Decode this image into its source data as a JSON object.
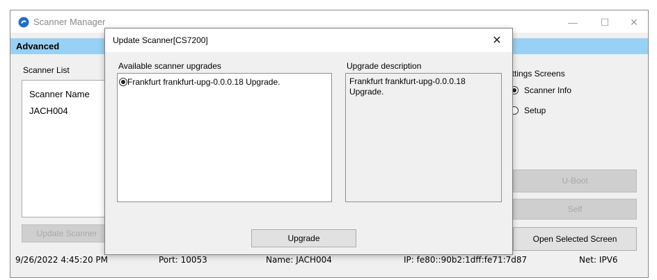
{
  "app": {
    "title": "Scanner Manager",
    "tab": "Advanced",
    "controls": {
      "minimize": "—",
      "maximize": "☐",
      "close": "✕"
    }
  },
  "scanner_list": {
    "label": "Scanner List",
    "column_header": "Scanner Name",
    "rows": [
      "JACH004"
    ],
    "update_button": "Update Scanner"
  },
  "settings": {
    "label": "Settings Screens",
    "options": [
      {
        "label": "Scanner Info",
        "selected": true
      },
      {
        "label": "Setup",
        "selected": false
      }
    ],
    "button_1": "U-Boot",
    "button_2": "Self",
    "open_button": "Open Selected Screen"
  },
  "status_bar": {
    "datetime": "9/26/2022 4:45:20 PM",
    "port": "Port: 10053",
    "name": "Name: JACH004",
    "ip": "IP: fe80::90b2:1dff:fe71:7d87",
    "net": "Net: IPV6"
  },
  "dialog": {
    "title": "Update Scanner[CS7200]",
    "close": "✕",
    "available_label": "Available scanner upgrades",
    "upgrades": [
      {
        "label": "Frankfurt frankfurt-upg-0.0.0.18 Upgrade.",
        "selected": true
      }
    ],
    "description_label": "Upgrade description",
    "description": "Frankfurt frankfurt-upg-0.0.0.18 Upgrade.",
    "upgrade_button": "Upgrade"
  }
}
